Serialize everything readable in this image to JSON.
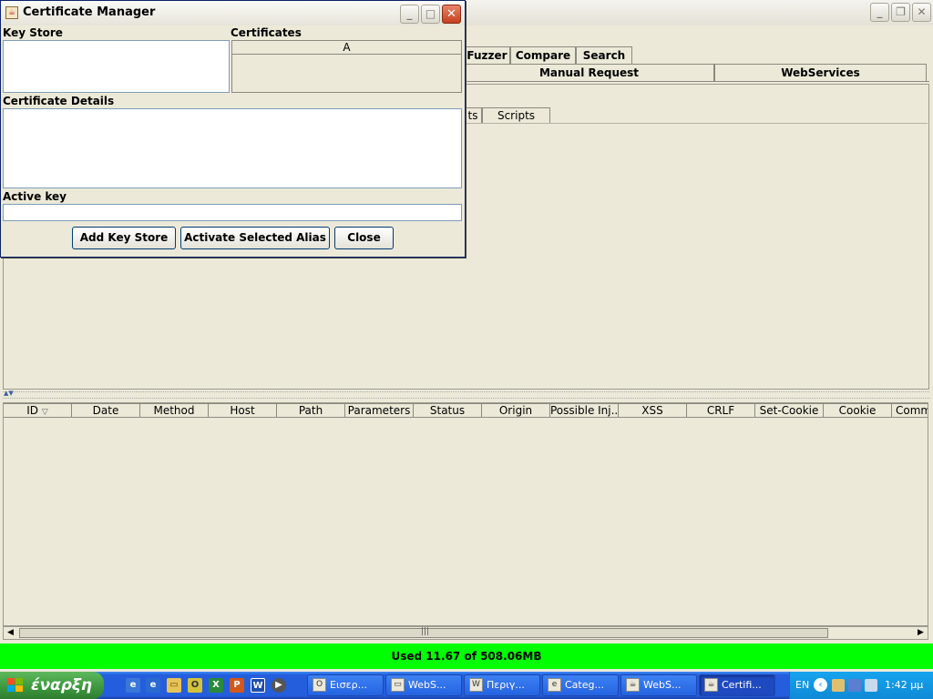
{
  "main_window": {
    "tabs_row1": [
      "Fuzzer",
      "Compare",
      "Search"
    ],
    "tabs_row2": [
      "Manual Request",
      "WebServices"
    ],
    "subtabs": [
      "ts",
      "Scripts"
    ],
    "table_columns": [
      "ID",
      "Date",
      "Method",
      "Host",
      "Path",
      "Parameters",
      "Status",
      "Origin",
      "Possible Inj...",
      "XSS",
      "CRLF",
      "Set-Cookie",
      "Cookie",
      "Comm"
    ],
    "sort_indicator": "▽",
    "status_bar": "Used 11.67 of 508.06MB"
  },
  "cert_dialog": {
    "title": "Certificate Manager",
    "key_store_label": "Key Store",
    "certificates_label": "Certificates",
    "certificates_column": "A",
    "details_label": "Certificate Details",
    "active_key_label": "Active key",
    "active_key_value": "",
    "buttons": {
      "add_key_store": "Add Key Store",
      "activate_alias": "Activate Selected Alias",
      "close": "Close"
    }
  },
  "taskbar": {
    "start_label": "έναρξη",
    "tasks": [
      "Εισερ...",
      "WebS...",
      "Περιγ...",
      "Categ...",
      "WebS...",
      "Certifi..."
    ],
    "tray_lang": "EN",
    "clock": "1:42 μμ"
  },
  "colors": {
    "status_green": "#00ff00",
    "taskbar_blue": "#245edc",
    "start_green": "#3c963c",
    "tray_blue": "#0f8ad6",
    "close_red": "#c4401e"
  }
}
